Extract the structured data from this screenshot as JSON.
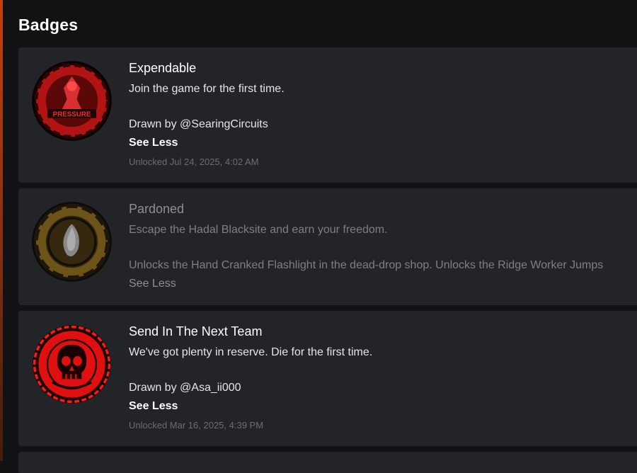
{
  "section": {
    "title": "Badges"
  },
  "badges": [
    {
      "name": "Expendable",
      "description": "Join the game for the first time.",
      "credit": "Drawn by @SearingCircuits",
      "toggle_label": "See Less",
      "unlocked": "Unlocked Jul 24, 2025, 4:02 AM",
      "icon": "pressure-logo-icon",
      "icon_text": "PRESSURE",
      "colors": {
        "primary": "#c01818",
        "secondary": "#1a0606"
      }
    },
    {
      "name": "Pardoned",
      "description": "Escape the Hadal Blacksite and earn your freedom.",
      "credit": "Unlocks the Hand Cranked Flashlight in the dead-drop shop. Unlocks the Ridge Worker Jumps",
      "toggle_label": "See Less",
      "locked": true,
      "icon": "pardoned-crystal-icon",
      "colors": {
        "primary": "#7a5c14",
        "secondary": "#1c1406"
      }
    },
    {
      "name": "Send In The Next Team",
      "description": "We've got plenty in reserve. Die for the first time.",
      "credit": "Drawn by @Asa_ii000",
      "toggle_label": "See Less",
      "unlocked": "Unlocked Mar 16, 2025, 4:39 PM",
      "icon": "skull-icon",
      "colors": {
        "primary": "#ff1a1a",
        "secondary": "#1a0000"
      }
    }
  ],
  "theme": {
    "background": "#121215",
    "card": "#232428",
    "muted": "#6b6d74"
  }
}
